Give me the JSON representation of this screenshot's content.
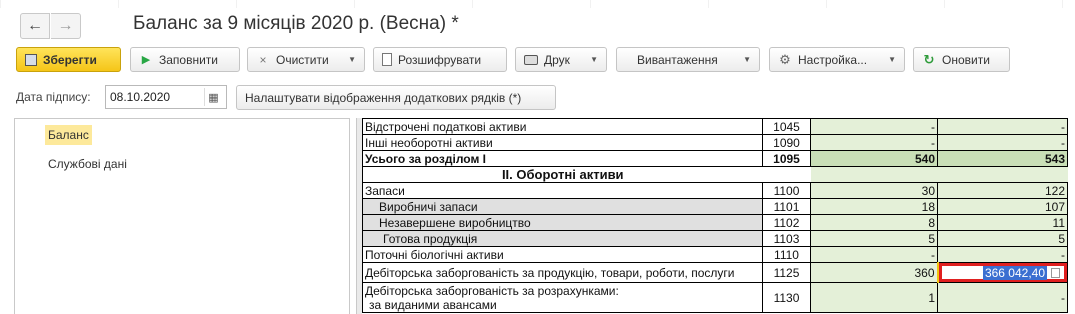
{
  "window": {
    "title": "Баланс за 9 місяців 2020 р. (Весна) *"
  },
  "nav": {
    "back_icon": "←",
    "forward_icon": "→"
  },
  "toolbar": {
    "save": "Зберегти",
    "fill": "Заповнити",
    "clear": "Очистити",
    "decode": "Розшифрувати",
    "print": "Друк",
    "export": "Вивантаження",
    "settings": "Настройка...",
    "refresh": "Оновити"
  },
  "signature_date": {
    "label": "Дата підпису:",
    "value": "08.10.2020"
  },
  "configure_rows_button": "Налаштувати відображення додаткових рядків (*)",
  "sidebar": {
    "items": [
      {
        "label": "Баланс",
        "selected": true
      },
      {
        "label": "Службові дані",
        "selected": false
      }
    ]
  },
  "grid": {
    "rows": [
      {
        "name": "Відстрочені податкові активи",
        "code": "1045",
        "begin": "-",
        "end": "-",
        "style": "normal"
      },
      {
        "name": "Інші необоротні активи",
        "code": "1090",
        "begin": "-",
        "end": "-",
        "style": "normal"
      },
      {
        "name": "Усього за розділом I",
        "code": "1095",
        "begin": "540",
        "end": "543",
        "style": "bold"
      },
      {
        "name": "II. Оборотні активи",
        "code": "",
        "begin": "",
        "end": "",
        "style": "section"
      },
      {
        "name": "Запаси",
        "code": "1100",
        "begin": "30",
        "end": "122",
        "style": "normal"
      },
      {
        "name": "Виробничі запаси",
        "code": "1101",
        "begin": "18",
        "end": "107",
        "style": "grey1"
      },
      {
        "name": "Незавершене виробництво",
        "code": "1102",
        "begin": "8",
        "end": "11",
        "style": "grey1"
      },
      {
        "name": "Готова  продукція",
        "code": "1103",
        "begin": "5",
        "end": "5",
        "style": "grey2"
      },
      {
        "name": "Поточні біологічні активи",
        "code": "1110",
        "begin": "-",
        "end": "-",
        "style": "normal"
      },
      {
        "name": "Дебіторська заборгованість за продукцію, товари, роботи, послуги",
        "code": "1125",
        "begin": "360",
        "end": "366 042,40",
        "style": "active"
      },
      {
        "name": "Дебіторська заборгованість за розрахунками:",
        "name2": "за виданими авансами",
        "code": "1130",
        "begin": "1",
        "end": "-",
        "style": "double"
      }
    ]
  },
  "colors": {
    "save_button": "#f5c518",
    "value_cell": "#e4f0d8",
    "total_cell": "#c9dfb7",
    "active_border": "#e02020",
    "selection": "#3b6fd1",
    "sidebar_selected": "#fde99b"
  }
}
